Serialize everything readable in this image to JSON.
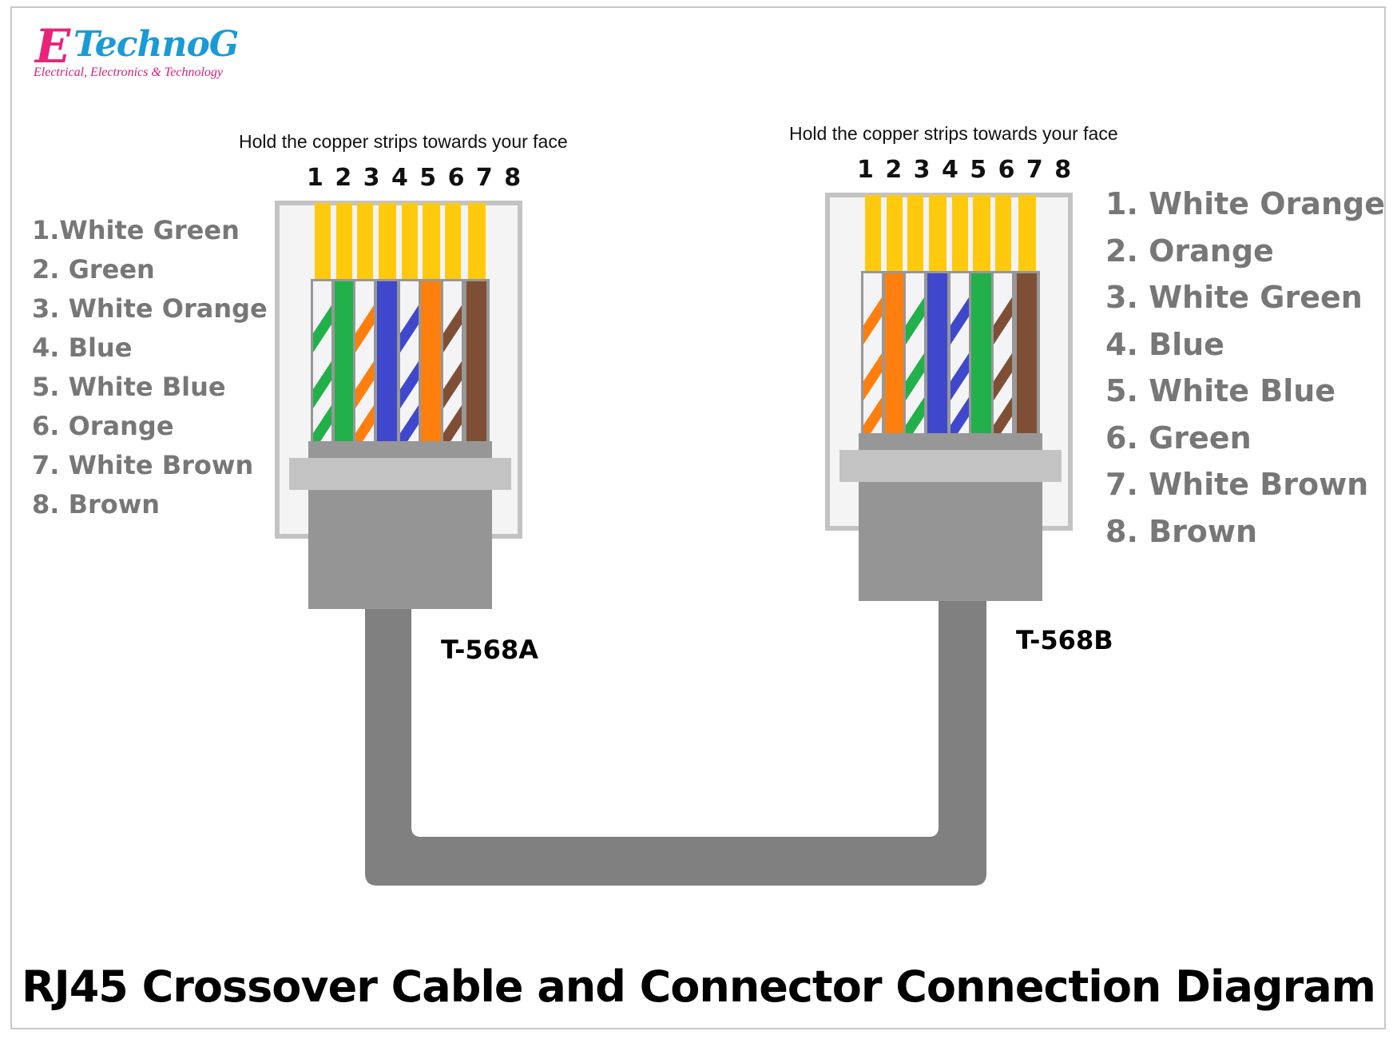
{
  "logo": {
    "initial": "E",
    "name": "TechnoG",
    "tagline": "Electrical, Electronics & Technology",
    "colors": {
      "initial": "#e8237a",
      "name": "#1a9ad6",
      "tagline": "#d6207a"
    }
  },
  "left_connector": {
    "instruction": "Hold the copper strips towards your face",
    "pin_numbers": "1 2 3 4 5 6 7 8",
    "standard": "T-568A",
    "wires": [
      {
        "pin": 1,
        "label": "1.White Green",
        "color": "green",
        "striped": true
      },
      {
        "pin": 2,
        "label": "2. Green",
        "color": "green",
        "striped": false
      },
      {
        "pin": 3,
        "label": "3. White Orange",
        "color": "orange",
        "striped": true
      },
      {
        "pin": 4,
        "label": "4. Blue",
        "color": "blue",
        "striped": false
      },
      {
        "pin": 5,
        "label": "5. White Blue",
        "color": "blue",
        "striped": true
      },
      {
        "pin": 6,
        "label": "6. Orange",
        "color": "orange",
        "striped": false
      },
      {
        "pin": 7,
        "label": "7.  White Brown",
        "color": "brown",
        "striped": true
      },
      {
        "pin": 8,
        "label": "8. Brown",
        "color": "brown",
        "striped": false
      }
    ]
  },
  "right_connector": {
    "instruction": "Hold the copper strips towards your face",
    "pin_numbers": "1 2 3 4 5 6 7 8",
    "standard": "T-568B",
    "wires": [
      {
        "pin": 1,
        "label": "1. White Orange",
        "color": "orange",
        "striped": true
      },
      {
        "pin": 2,
        "label": "2. Orange",
        "color": "orange",
        "striped": false
      },
      {
        "pin": 3,
        "label": "3. White Green",
        "color": "green",
        "striped": true
      },
      {
        "pin": 4,
        "label": "4. Blue",
        "color": "blue",
        "striped": false
      },
      {
        "pin": 5,
        "label": "5. White Blue",
        "color": "blue",
        "striped": true
      },
      {
        "pin": 6,
        "label": "6. Green",
        "color": "green",
        "striped": false
      },
      {
        "pin": 7,
        "label": "7. White Brown",
        "color": "brown",
        "striped": true
      },
      {
        "pin": 8,
        "label": "8. Brown",
        "color": "brown",
        "striped": false
      }
    ]
  },
  "wire_colors": {
    "green": "#22b04b",
    "orange": "#ff7f0e",
    "blue": "#3f48cc",
    "brown": "#7f4f35",
    "white": "#f4f4f6",
    "copper": "#ffca0e"
  },
  "connector_colors": {
    "shell_border": "#c3c3c3",
    "shell_fill": "#f4f4f4",
    "wire_bed": "#979797",
    "crimp_band": "#c3c3c3",
    "body": "#959595",
    "cable": "#808080"
  },
  "title": "RJ45 Crossover Cable and Connector Connection Diagram"
}
